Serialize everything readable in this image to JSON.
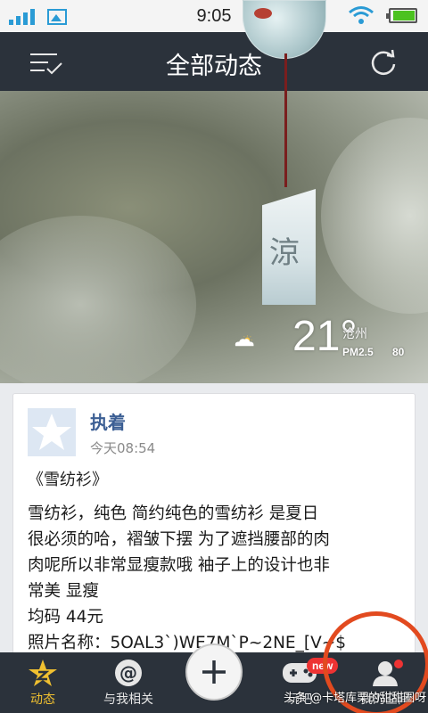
{
  "status_bar": {
    "time": "9:05",
    "icons": [
      "signal-icon",
      "gallery-icon",
      "wifi-icon",
      "battery-icon"
    ],
    "battery_level": 0.85
  },
  "header": {
    "title": "全部动态",
    "left_icon": "menu-check-icon",
    "right_icon": "refresh-icon"
  },
  "banner": {
    "strip_text": "涼",
    "weather": {
      "icon": "partly-cloudy-icon",
      "temperature": "21°",
      "city": "沧州",
      "pm_label": "PM2.5",
      "pm_value": "80"
    }
  },
  "post": {
    "username": "执着",
    "time": "今天08:54",
    "title": "《雪纺衫》",
    "body_lines": [
      "雪纺衫，纯色 简约纯色的雪纺衫 是夏日",
      "很必须的哈，褶皱下摆 为了遮挡腰部的肉",
      "肉呢所以非常显瘦款哦 袖子上的设计也非",
      "常美 显瘦",
      "均码 44元",
      "照片名称：5OAL3`)WE7M`P~2NE_[V~$"
    ]
  },
  "bottom_nav": {
    "items": [
      {
        "label": "动态",
        "icon": "star-icon",
        "active": true
      },
      {
        "label": "与我相关",
        "icon": "at-icon",
        "active": false
      },
      {
        "label": "",
        "icon": "plus-icon",
        "active": false
      },
      {
        "label": "玩吧",
        "icon": "gamepad-icon",
        "active": false,
        "badge": "new"
      },
      {
        "label": "我的空间",
        "icon": "profile-icon",
        "active": false
      }
    ]
  },
  "watermark": "头条 @卡塔库栗的甜甜圈呀",
  "colors": {
    "header_bg": "#2b323b",
    "accent": "#f0c030",
    "link": "#3c5f94",
    "badge": "#ee3333",
    "highlight": "#e24a1f"
  }
}
